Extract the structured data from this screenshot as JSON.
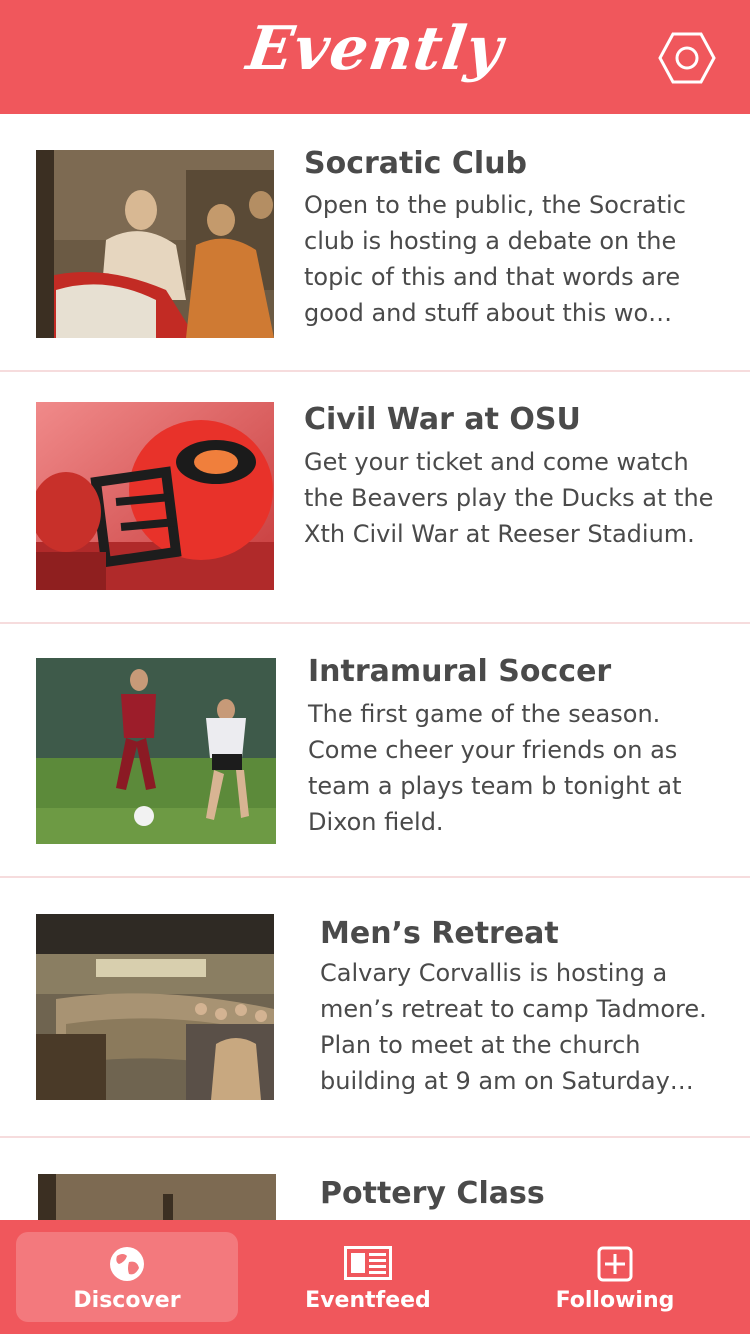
{
  "header": {
    "logo": "Evently",
    "settings_icon": "hexagon-settings-icon"
  },
  "events": [
    {
      "title": "Socratic Club",
      "description": "Open to the public, the Socratic club is hosting a debate on the topic of this and that words are good and stuff about this wo…",
      "image": "painting-image"
    },
    {
      "title": "Civil War at OSU",
      "description": "Get your ticket and come watch the Beavers play the Ducks at the Xth Civil War at Reeser Stadium.",
      "image": "football-helmet-image"
    },
    {
      "title": "Intramural Soccer",
      "description": "The first game of the season. Come cheer your friends on as team a plays team b tonight at Dixon field.",
      "image": "soccer-players-image"
    },
    {
      "title": "Men’s Retreat",
      "description": "Calvary Corvallis is hosting a men’s retreat to camp Tadmore. Plan to meet at the church building at 9 am on Saturday…",
      "image": "church-audience-image"
    },
    {
      "title": "Pottery Class",
      "description": "",
      "image": "painting-image"
    }
  ],
  "tabs": [
    {
      "label": "Discover",
      "icon": "globe-icon",
      "active": true
    },
    {
      "label": "Eventfeed",
      "icon": "newspaper-icon",
      "active": false
    },
    {
      "label": "Following",
      "icon": "plus-square-icon",
      "active": false
    }
  ],
  "colors": {
    "brand": "#f0575c",
    "active_tab": "#f3797d",
    "text": "#4a4a4a",
    "divider": "#f6dcdd"
  }
}
